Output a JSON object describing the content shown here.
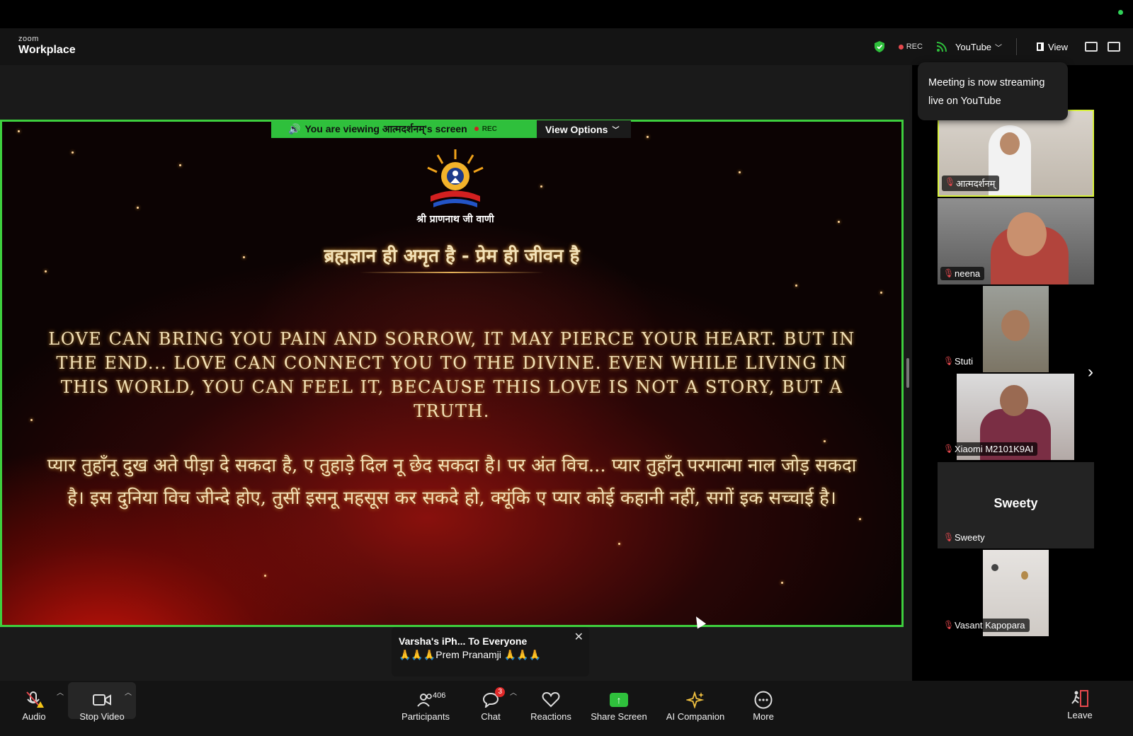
{
  "app": {
    "brand_small": "zoom",
    "brand_big": "Workplace"
  },
  "topbar": {
    "rec_label": "REC",
    "stream_label": "YouTube",
    "view_label": "View"
  },
  "tooltip": {
    "text": "Meeting is now streaming live on YouTube"
  },
  "share_banner": {
    "viewing_text": "You are viewing आत्मदर्शनम्'s screen",
    "rec_label": "REC",
    "options_label": "View Options"
  },
  "shared_content": {
    "logo_text": "श्री प्राणनाथ जी वाणी",
    "tagline": "ब्रह्मज्ञान ही अमृत है - प्रेम ही जीवन है",
    "english_text": "LOVE CAN BRING YOU PAIN AND SORROW, IT MAY PIERCE YOUR HEART. BUT IN THE END... LOVE CAN CONNECT YOU TO THE DIVINE. EVEN WHILE LIVING IN THIS WORLD, YOU CAN FEEL IT, BECAUSE THIS LOVE IS NOT A STORY, BUT A TRUTH.",
    "punjabi_text": "प्यार तुहाँनू दुख अते पीड़ा दे सकदा है, ए तुहाड़े दिल नू छेद सकदा है। पर अंत विच... प्यार तुहाँनू परमात्मा नाल जोड़ सकदा है। इस दुनिया विच जीन्दे होए, तुसीं इसनू महसूस कर सकदे हो, क्यूंकि ए प्यार कोई कहानी नहीं, सगों इक सच्चाई है।"
  },
  "chat_toast": {
    "title": "Varsha's iPh... To Everyone",
    "message": "🙏🙏🙏Prem Pranamji 🙏🙏🙏"
  },
  "participants": [
    {
      "name": "आत्मदर्शनम्",
      "active": true
    },
    {
      "name": "neena"
    },
    {
      "name": "Stuti"
    },
    {
      "name": "Xiaomi M2101K9AI"
    },
    {
      "name": "Sweety",
      "video_off_label": "Sweety"
    },
    {
      "name": "Vasant Kapopara"
    }
  ],
  "bottombar": {
    "audio": "Audio",
    "stop_video": "Stop Video",
    "participants": "Participants",
    "participants_count": "406",
    "chat": "Chat",
    "chat_badge": "3",
    "reactions": "Reactions",
    "share_screen": "Share Screen",
    "ai_companion": "AI Companion",
    "more": "More",
    "leave": "Leave"
  },
  "colors": {
    "share_border": "#3ecf3e",
    "banner_green": "#2fc03c",
    "active_speaker": "#d8f23c",
    "rec_red": "#e5484d"
  }
}
